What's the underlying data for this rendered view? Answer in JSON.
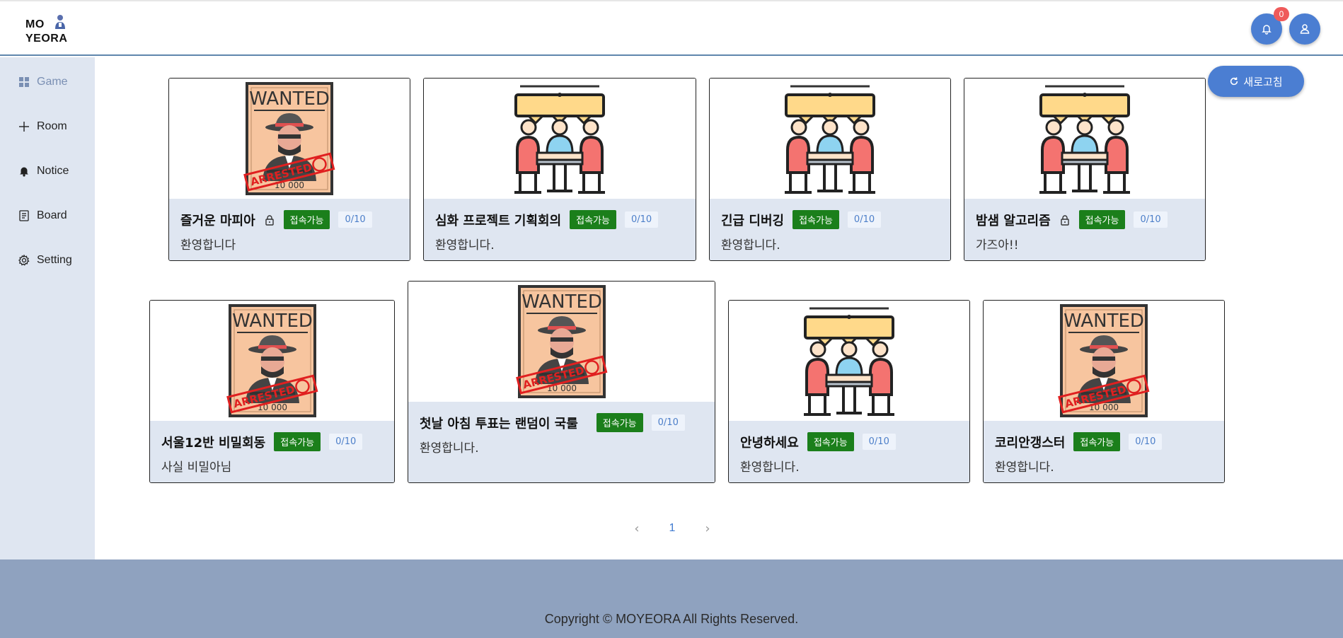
{
  "logo": {
    "line1": "MO",
    "line2": "YEORA"
  },
  "header": {
    "notification_count": "0",
    "bell_icon": "bell-icon",
    "user_icon": "user-icon"
  },
  "sidebar": {
    "items": [
      {
        "label": "Game",
        "icon": "grid-icon",
        "active": true
      },
      {
        "label": "Room",
        "icon": "plus-icon"
      },
      {
        "label": "Notice",
        "icon": "bell-icon"
      },
      {
        "label": "Board",
        "icon": "document-icon"
      },
      {
        "label": "Setting",
        "icon": "gear-icon"
      }
    ]
  },
  "refresh_label": "새로고침",
  "rooms": [
    {
      "title": "즐거운 마피아",
      "locked": true,
      "status": "접속가능",
      "count": "0/10",
      "desc": "환영합니다",
      "image": "wanted-poster"
    },
    {
      "title": "심화 프로젝트 기획회의",
      "locked": false,
      "status": "접속가능",
      "count": "0/10",
      "desc": "환영합니다.",
      "image": "meeting"
    },
    {
      "title": "긴급 디버깅",
      "locked": false,
      "status": "접속가능",
      "count": "0/10",
      "desc": "환영합니다.",
      "image": "meeting"
    },
    {
      "title": "밤샘 알고리즘",
      "locked": true,
      "status": "접속가능",
      "count": "0/10",
      "desc": "가즈아!!",
      "image": "meeting"
    },
    {
      "title": "서울12반 비밀회동",
      "locked": false,
      "status": "접속가능",
      "count": "0/10",
      "desc": "사실 비밀아님",
      "image": "wanted-poster"
    },
    {
      "title": "첫날 아침 투표는 랜덤이 국룰",
      "locked": false,
      "status": "접속가능",
      "count": "0/10",
      "desc": "환영합니다.",
      "image": "wanted-poster"
    },
    {
      "title": "안녕하세요",
      "locked": false,
      "status": "접속가능",
      "count": "0/10",
      "desc": "환영합니다.",
      "image": "meeting"
    },
    {
      "title": "코리안갱스터",
      "locked": false,
      "status": "접속가능",
      "count": "0/10",
      "desc": "환영합니다.",
      "image": "wanted-poster"
    }
  ],
  "pagination": {
    "current": "1",
    "prev": "‹",
    "next": "›"
  },
  "footer": {
    "copyright": "Copyright © MOYEORA All Rights Reserved."
  },
  "colors": {
    "accent": "#4b7ed2",
    "status_green": "#1b7f1b",
    "sidebar_bg": "#dfe6f1",
    "footer_bg": "#8fa2bf"
  }
}
